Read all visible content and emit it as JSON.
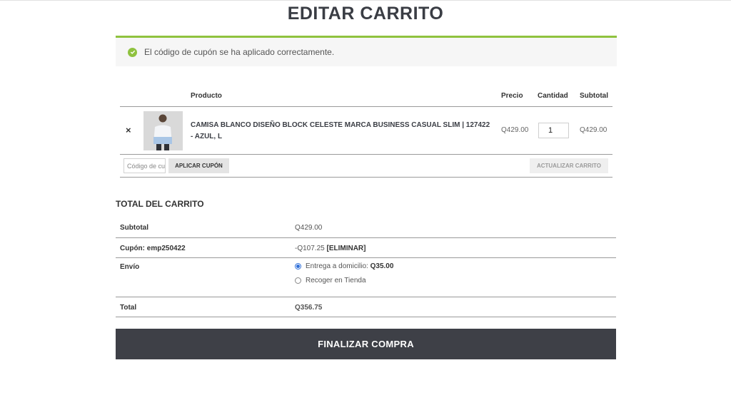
{
  "page": {
    "title": "EDITAR CARRITO"
  },
  "notice": {
    "message": "El código de cupón se ha aplicado correctamente.",
    "color": "#8fc23f"
  },
  "cart": {
    "headers": {
      "product": "Producto",
      "price": "Precio",
      "quantity": "Cantidad",
      "subtotal": "Subtotal"
    },
    "items": [
      {
        "name": "CAMISA BLANCO DISEÑO BLOCK CELESTE MARCA BUSINESS CASUAL SLIM | 127422 - AZUL, L",
        "price": "Q429.00",
        "quantity": "1",
        "subtotal": "Q429.00"
      }
    ],
    "remove_glyph": "×",
    "coupon_placeholder": "Código de cupón",
    "apply_coupon_label": "APLICAR CUPÓN",
    "update_cart_label": "ACTUALIZAR CARRITO"
  },
  "totals": {
    "title": "TOTAL DEL CARRITO",
    "subtotal_label": "Subtotal",
    "subtotal_value": "Q429.00",
    "coupon_label": "Cupón: emp250422",
    "coupon_value": "-Q107.25",
    "coupon_remove": "[ELIMINAR]",
    "shipping_label": "Envío",
    "shipping_options": [
      {
        "label": "Entrega a domicilio:",
        "price": "Q35.00",
        "selected": true
      },
      {
        "label": "Recoger en Tienda",
        "selected": false
      }
    ],
    "total_label": "Total",
    "total_value": "Q356.75"
  },
  "checkout": {
    "label": "FINALIZAR COMPRA",
    "color": "#3e4047"
  }
}
